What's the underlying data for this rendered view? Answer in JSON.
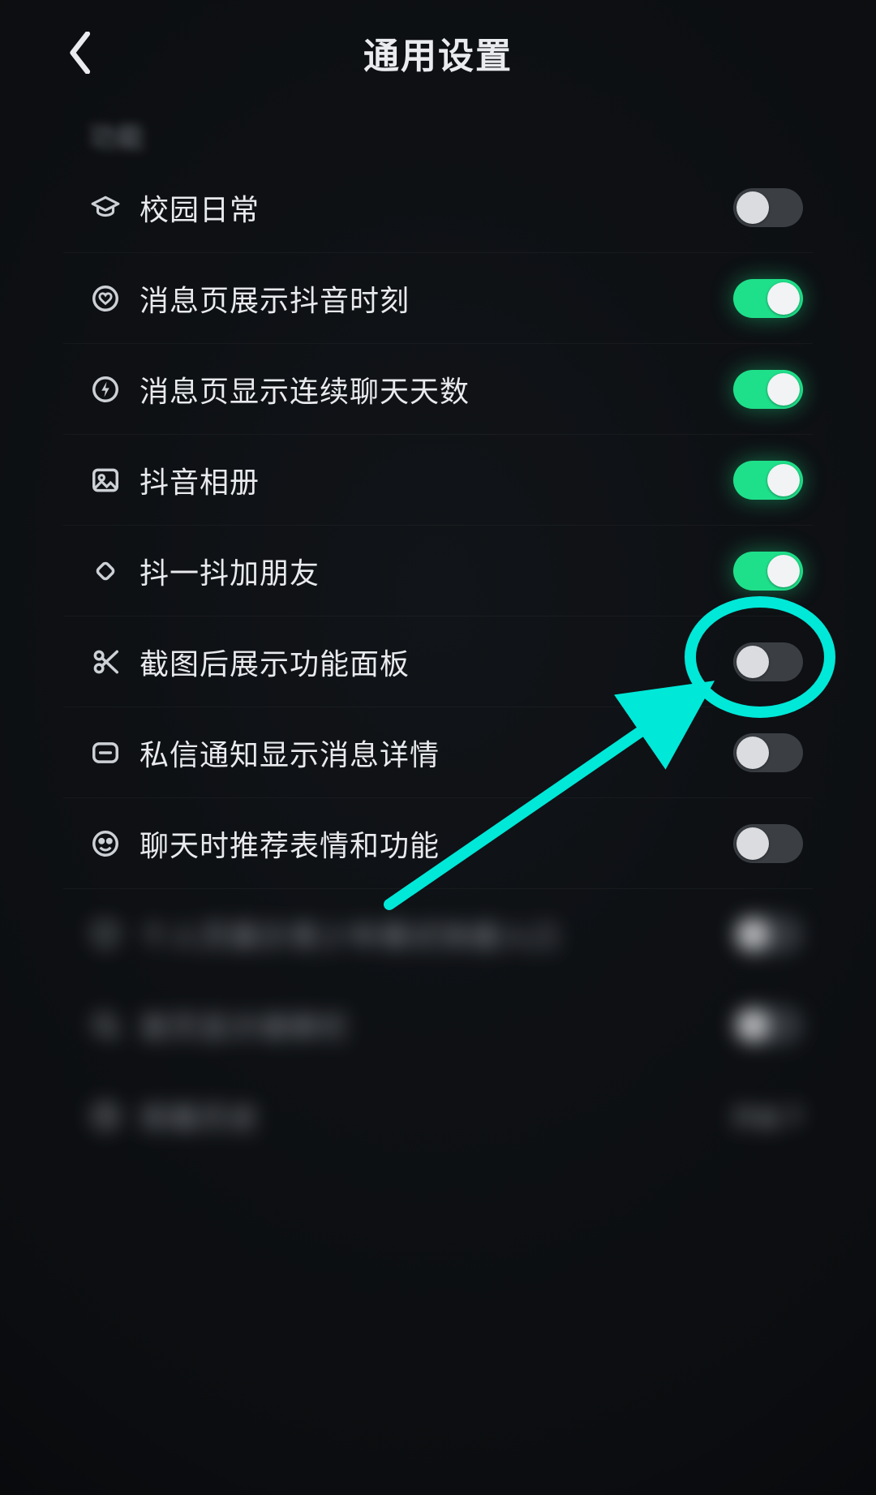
{
  "colors": {
    "accent_toggle_on": "#1FE08A",
    "annotation": "#00E8D8"
  },
  "header": {
    "title": "通用设置",
    "back_icon": "chevron-left"
  },
  "section": {
    "label": "功能"
  },
  "items": [
    {
      "icon": "graduation-cap-icon",
      "label": "校园日常",
      "on": false,
      "interactable": true,
      "blurred": false
    },
    {
      "icon": "heart-circle-icon",
      "label": "消息页展示抖音时刻",
      "on": true,
      "interactable": true,
      "blurred": false
    },
    {
      "icon": "bolt-circle-icon",
      "label": "消息页显示连续聊天天数",
      "on": true,
      "interactable": true,
      "blurred": false
    },
    {
      "icon": "photo-icon",
      "label": "抖音相册",
      "on": true,
      "interactable": true,
      "blurred": false
    },
    {
      "icon": "shake-icon",
      "label": "抖一抖加朋友",
      "on": true,
      "interactable": true,
      "blurred": false
    },
    {
      "icon": "scissors-icon",
      "label": "截图后展示功能面板",
      "on": false,
      "interactable": true,
      "blurred": false,
      "annotated": true
    },
    {
      "icon": "message-icon",
      "label": "私信通知显示消息详情",
      "on": false,
      "interactable": true,
      "blurred": false
    },
    {
      "icon": "face-icon",
      "label": "聊天时推荐表情和功能",
      "on": false,
      "interactable": true,
      "blurred": false
    },
    {
      "icon": "shield-icon",
      "label": "个人页展示青少年模式快捷入口",
      "on": false,
      "interactable": true,
      "blurred": true
    },
    {
      "icon": "search-icon",
      "label": "首页显示搜索栏",
      "on": false,
      "interactable": true,
      "blurred": true
    },
    {
      "icon": "clock-icon",
      "label": "观看历史",
      "trail": "开启",
      "interactable": true,
      "blurred": true
    }
  ]
}
